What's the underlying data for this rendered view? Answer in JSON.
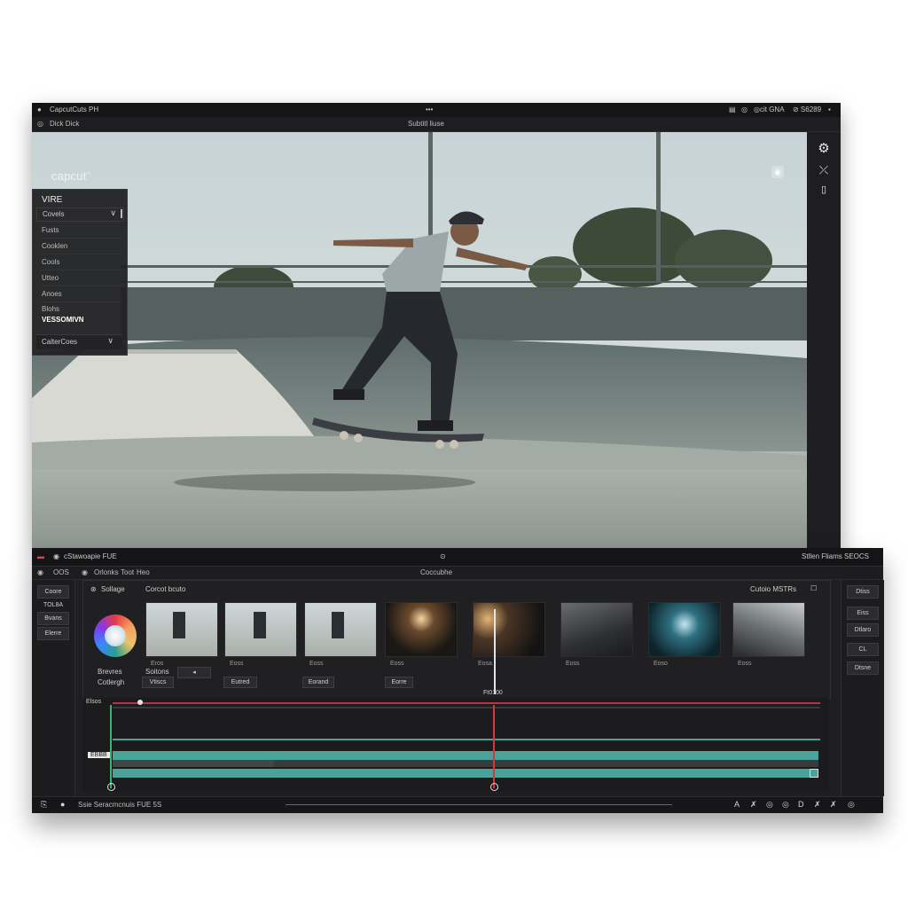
{
  "top_window": {
    "title": "CapcutCuts PH",
    "menu_dots": "•••",
    "title_right": [
      "▤",
      "◎",
      "◎cit GNA",
      "⊘ S6289"
    ],
    "toolbar_left": "Dick Dick",
    "toolbar_center": "Subtitl liuse",
    "logo_text": "capcut",
    "logo_mark": "™",
    "preview_corner_icon": "◉",
    "rail_icons": [
      "gear-icon",
      "cut-icon",
      "layout-icon"
    ],
    "side_menu": {
      "heading": "VIRE",
      "dropdown_label": "Covels",
      "dropdown_chevron": "∨",
      "items": [
        "Fusts",
        "Cooklen",
        "Cools",
        "Utteo",
        "Anoes",
        "Blohs"
      ],
      "bold_item": "VESSOMIVN",
      "footer_label": "CalterCoes",
      "footer_chevron": "∨"
    }
  },
  "bottom_window": {
    "title": "cStawoapie FUE",
    "center_icon": "⊙",
    "title_right": "Stllen   Fliams   SEOCS",
    "toolbar_left": "OOS",
    "toolbar_items": [
      "Orlonks",
      "Toot",
      "Heo"
    ],
    "toolbar_center": "Coccubhe",
    "left_col": [
      "Coore",
      "TOL8A",
      "Bvans",
      "Elerre"
    ],
    "right_col": [
      "Dtiss",
      "Eiss",
      "Dtlaro",
      "CL",
      "Dtsne"
    ],
    "media_panel": {
      "tab1": "Sollage",
      "tab1_icon": "⊛",
      "tab2": "Corcot bcuto",
      "right_label": "Cutoio MSTRs",
      "color_label": "Brevres",
      "color_sub": "Cotlergh",
      "btn_a_label": "Soitons",
      "btn_a_sub": "Vtiscs",
      "btn_b_label": "◂",
      "thumb_captions": [
        "Eros",
        "Eoss",
        "Eoss",
        "Eoss",
        "Eosa",
        "Eoss",
        "Eoso",
        "Eoss"
      ],
      "row_buttons": [
        "Eutred",
        "Eorand",
        "Eorre"
      ]
    },
    "timeline": {
      "start_label": "Elsos",
      "ruler_label": "Ft0100",
      "track_tag": "EBBB"
    },
    "status": {
      "left_icons": [
        "folder-icon",
        "chat-icon"
      ],
      "left_text": "Ssie   Seracmcnuis FUE 5S",
      "right_icons": [
        "A",
        "✗",
        "◎",
        "◎",
        "D",
        "✗",
        "✗",
        "◎"
      ]
    }
  },
  "colors": {
    "panel_bg": "#1f1f21",
    "track_teal": "#4aa39a",
    "playhead_red": "#d9373a",
    "marker_green": "#3db46d"
  }
}
